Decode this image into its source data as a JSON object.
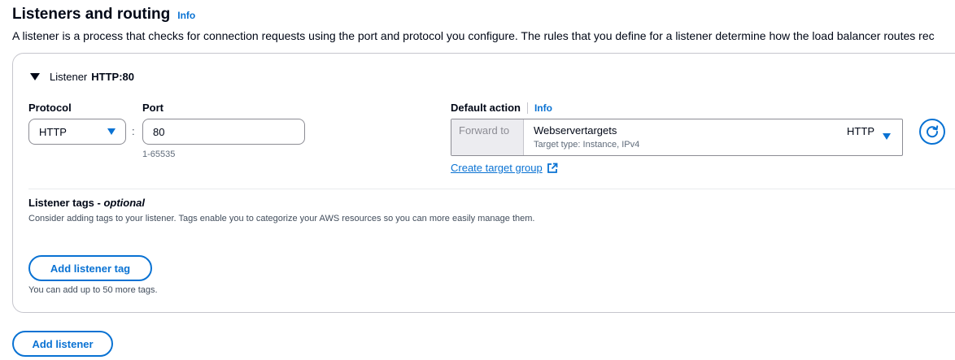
{
  "section": {
    "title": "Listeners and routing",
    "info": "Info",
    "description": "A listener is a process that checks for connection requests using the port and protocol you configure. The rules that you define for a listener determine how the load balancer routes rec"
  },
  "listener": {
    "prefix": "Listener",
    "name": "HTTP:80",
    "protocol": {
      "label": "Protocol",
      "value": "HTTP"
    },
    "colon": ":",
    "port": {
      "label": "Port",
      "value": "80",
      "hint": "1-65535"
    },
    "default_action": {
      "label": "Default action",
      "info": "Info",
      "forward_label": "Forward to",
      "target_group": "Webservertargets",
      "target_type": "Target type: Instance, IPv4",
      "target_protocol": "HTTP",
      "create_link": "Create target group"
    },
    "tags": {
      "title_main": "Listener tags - ",
      "title_optional": "optional",
      "description": "Consider adding tags to your listener. Tags enable you to categorize your AWS resources so you can more easily manage them.",
      "add_button": "Add listener tag",
      "limit_hint": "You can add up to 50 more tags."
    }
  },
  "add_listener_button": "Add listener",
  "colors": {
    "accent": "#0972d3",
    "text": "#000716",
    "border": "#8c8c94"
  },
  "icons": {
    "expand": "caret-down-icon",
    "dropdown": "triangle-down-icon",
    "refresh": "refresh-icon",
    "external": "external-link-icon"
  }
}
